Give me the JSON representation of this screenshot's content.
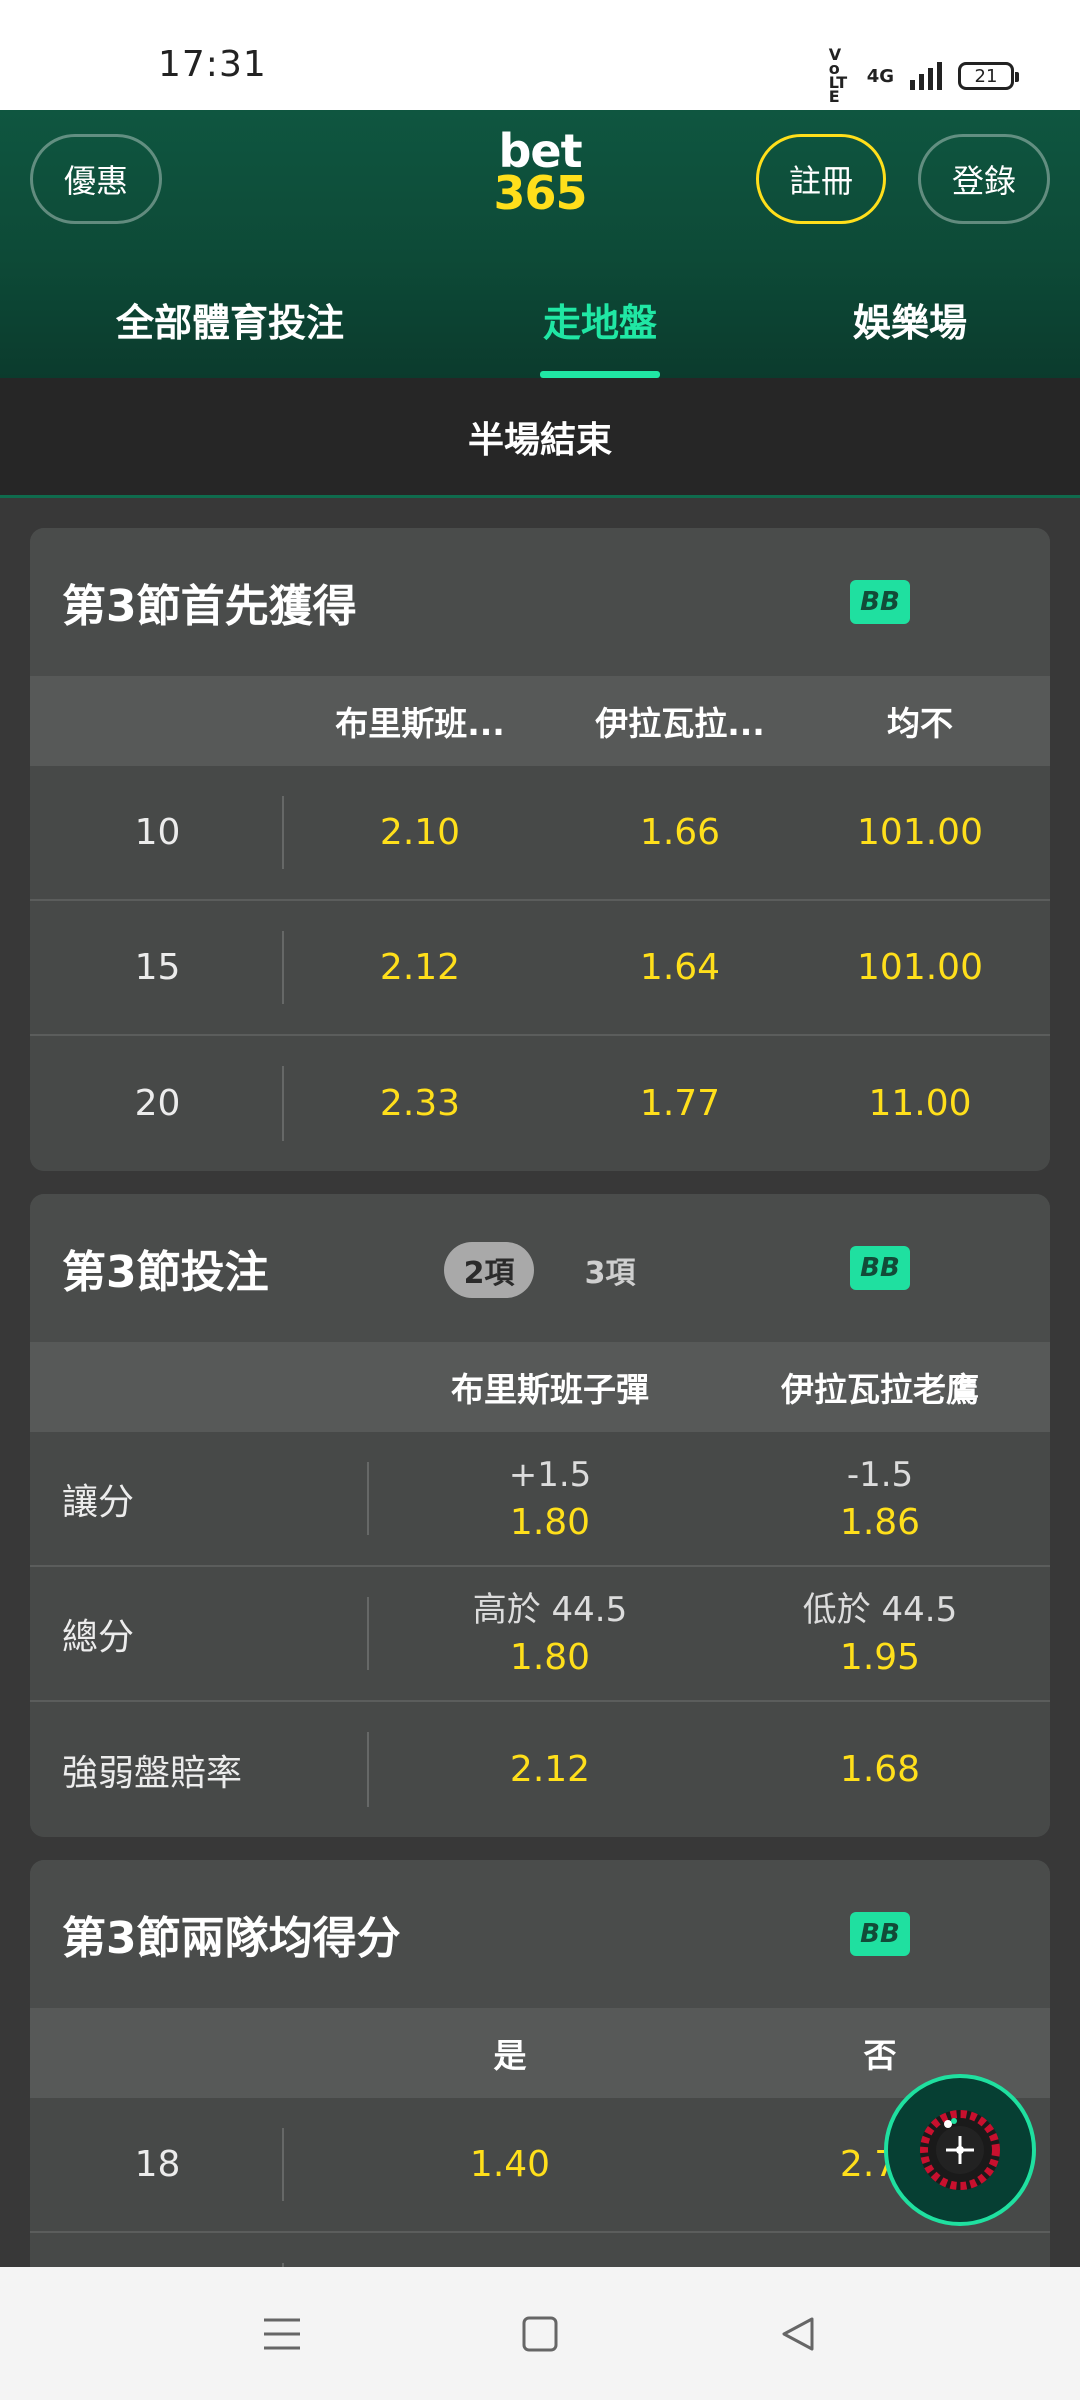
{
  "status": {
    "time": "17:31",
    "network": "4G",
    "volte": "Vo LTE",
    "battery": "21"
  },
  "header": {
    "promo_label": "優惠",
    "logo_top": "bet",
    "logo_bottom": "365",
    "register_label": "註冊",
    "login_label": "登錄",
    "tabs": [
      {
        "label": "全部體育投注",
        "active": false
      },
      {
        "label": "走地盤",
        "active": true
      },
      {
        "label": "娛樂場",
        "active": false
      }
    ]
  },
  "banner": {
    "text": "半場結束"
  },
  "card1": {
    "title": "第3節首先獲得",
    "badge": "BB",
    "columns": [
      "布里斯班...",
      "伊拉瓦拉...",
      "均不"
    ],
    "rows": [
      {
        "label": "10",
        "odds": [
          "2.10",
          "1.66",
          "101.00"
        ]
      },
      {
        "label": "15",
        "odds": [
          "2.12",
          "1.64",
          "101.00"
        ]
      },
      {
        "label": "20",
        "odds": [
          "2.33",
          "1.77",
          "11.00"
        ]
      }
    ]
  },
  "card2": {
    "title": "第3節投注",
    "toggle_on": "2項",
    "toggle_off": "3項",
    "badge": "BB",
    "columns": [
      "布里斯班子彈",
      "伊拉瓦拉老鷹"
    ],
    "rows": [
      {
        "label": "讓分",
        "a_line": "+1.5",
        "a_odd": "1.80",
        "b_line": "-1.5",
        "b_odd": "1.86"
      },
      {
        "label": "總分",
        "a_line": "高於 44.5",
        "a_odd": "1.80",
        "b_line": "低於 44.5",
        "b_odd": "1.95"
      },
      {
        "label": "強弱盤賠率",
        "a_line": "",
        "a_odd": "2.12",
        "b_line": "",
        "b_odd": "1.68"
      }
    ]
  },
  "card3": {
    "title": "第3節兩隊均得分",
    "badge": "BB",
    "columns": [
      "是",
      "否"
    ],
    "rows": [
      {
        "label": "18",
        "odds": [
          "1.40",
          "2.75"
        ]
      }
    ]
  },
  "colors": {
    "accent": "#20e7a4",
    "odds": "#ffdf1b",
    "header": "#0f5640"
  },
  "icons": {
    "fab": "roulette-icon",
    "nav": [
      "menu-icon",
      "home-square-icon",
      "back-triangle-icon"
    ]
  }
}
